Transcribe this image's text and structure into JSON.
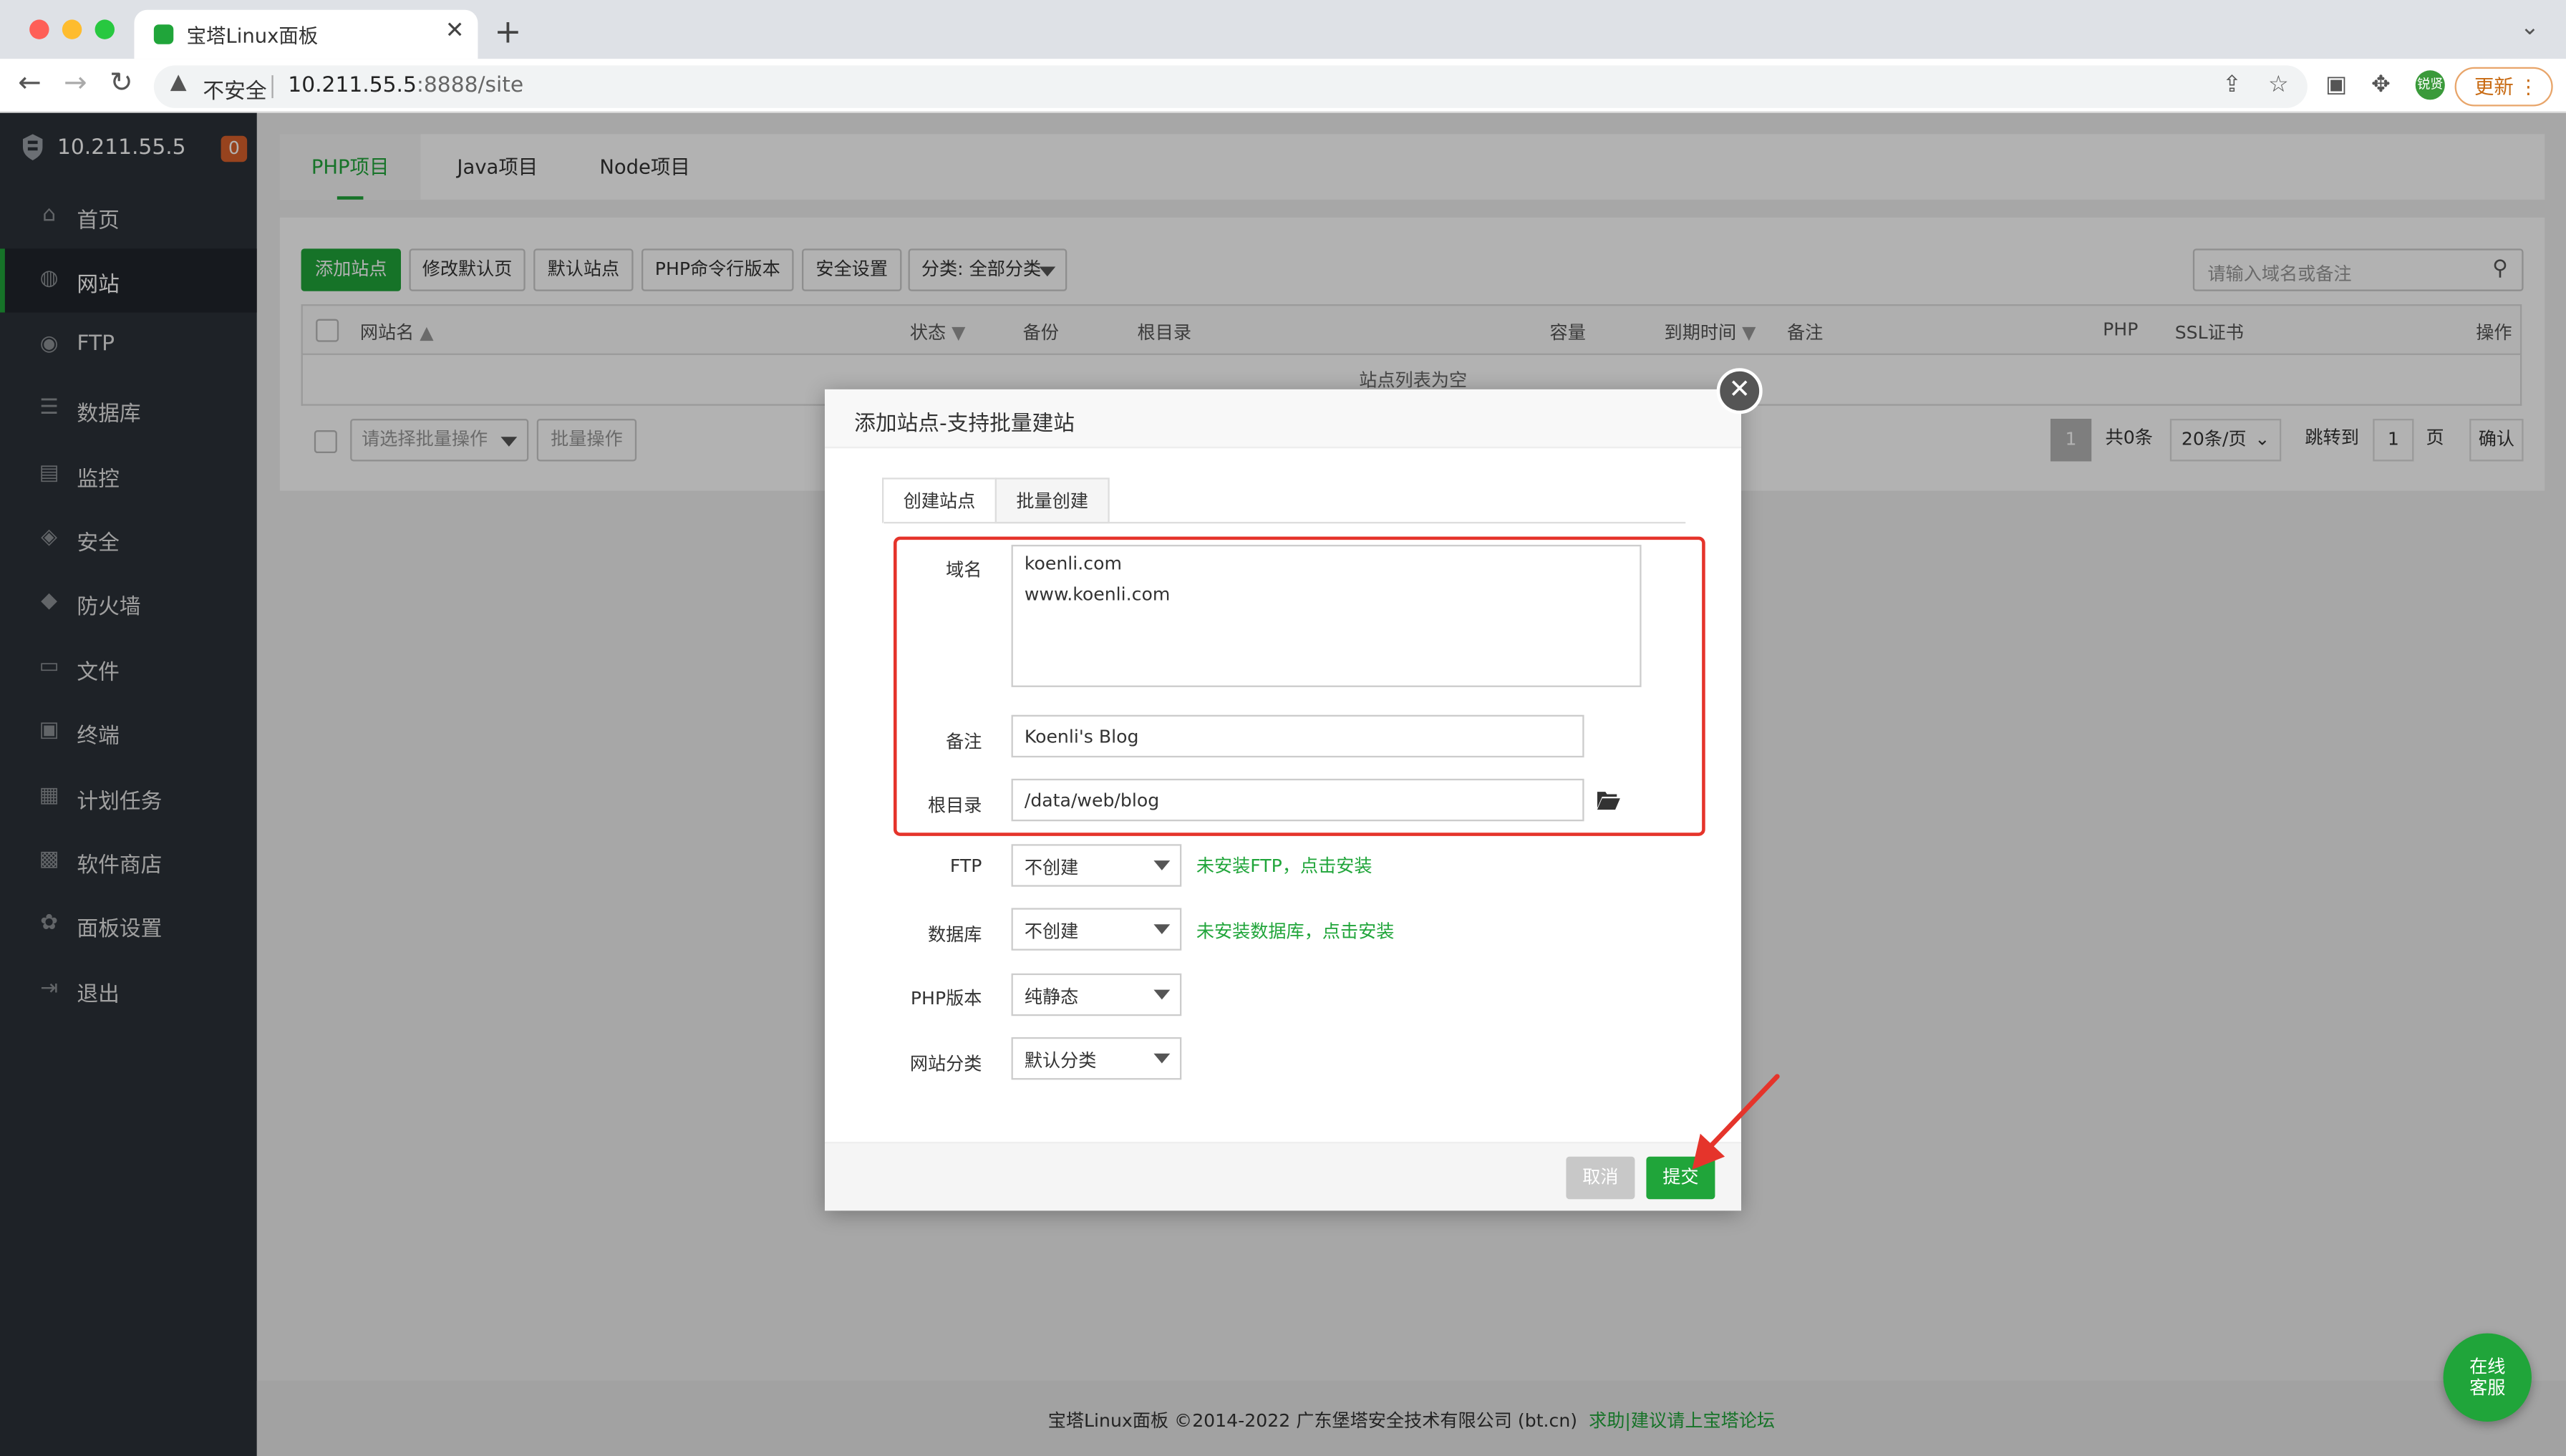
{
  "browser": {
    "tab_title": "宝塔Linux面板",
    "security_label": "不安全",
    "url_host": "10.211.55.5",
    "url_rest": ":8888/site",
    "update_label": "更新",
    "avatar_text": "锐贤"
  },
  "sidebar": {
    "server_ip": "10.211.55.5",
    "badge_count": "0",
    "items": [
      {
        "label": "首页",
        "icon": "home-icon"
      },
      {
        "label": "网站",
        "icon": "globe-icon"
      },
      {
        "label": "FTP",
        "icon": "ftp-icon"
      },
      {
        "label": "数据库",
        "icon": "database-icon"
      },
      {
        "label": "监控",
        "icon": "monitor-icon"
      },
      {
        "label": "安全",
        "icon": "shield-icon"
      },
      {
        "label": "防火墙",
        "icon": "firewall-icon"
      },
      {
        "label": "文件",
        "icon": "folder-icon"
      },
      {
        "label": "终端",
        "icon": "terminal-icon"
      },
      {
        "label": "计划任务",
        "icon": "calendar-icon"
      },
      {
        "label": "软件商店",
        "icon": "apps-icon"
      },
      {
        "label": "面板设置",
        "icon": "settings-icon"
      },
      {
        "label": "退出",
        "icon": "logout-icon"
      }
    ]
  },
  "project_tabs": [
    "PHP项目",
    "Java项目",
    "Node项目"
  ],
  "toolbar": {
    "add_site": "添加站点",
    "modify_default_page": "修改默认页",
    "default_site": "默认站点",
    "php_cli_version": "PHP命令行版本",
    "security_settings": "安全设置",
    "category_select": "分类: 全部分类",
    "search_placeholder": "请输入域名或备注"
  },
  "table": {
    "headers": [
      "网站名",
      "状态",
      "备份",
      "根目录",
      "容量",
      "到期时间",
      "备注",
      "PHP",
      "SSL证书",
      "操作"
    ],
    "empty_text": "站点列表为空",
    "batch_select_placeholder": "请选择批量操作",
    "batch_button": "批量操作"
  },
  "pagination": {
    "current_page": "1",
    "total": "共0条",
    "per_page": "20条/页",
    "jump_label": "跳转到",
    "jump_value": "1",
    "page_unit": "页",
    "confirm": "确认"
  },
  "footer": {
    "copyright": "宝塔Linux面板 ©2014-2022 广东堡塔安全技术有限公司 (bt.cn)",
    "link": "求助|建议请上宝塔论坛"
  },
  "online_service": [
    "在线",
    "客服"
  ],
  "modal": {
    "title": "添加站点-支持批量建站",
    "tabs": [
      "创建站点",
      "批量创建"
    ],
    "domain_label": "域名",
    "domain_lines": [
      "koenli.com",
      "www.koenli.com"
    ],
    "remark_label": "备注",
    "remark_value": "Koenli's Blog",
    "root_label": "根目录",
    "root_value": "/data/web/blog",
    "ftp_label": "FTP",
    "ftp_value": "不创建",
    "ftp_note": "未安装FTP，点击安装",
    "db_label": "数据库",
    "db_value": "不创建",
    "db_note": "未安装数据库，点击安装",
    "php_label": "PHP版本",
    "php_value": "纯静态",
    "category_label": "网站分类",
    "category_value": "默认分类",
    "cancel": "取消",
    "submit": "提交"
  },
  "colors": {
    "brand_green": "#20a53a",
    "sidebar_bg": "#2c3138",
    "highlight_red": "#e5342b"
  }
}
